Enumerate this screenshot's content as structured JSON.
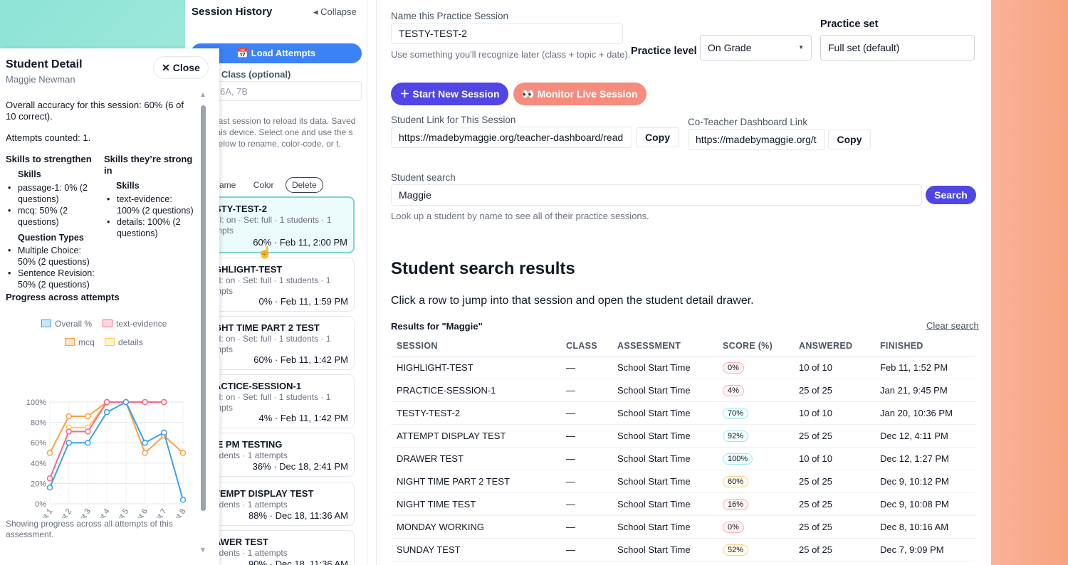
{
  "history": {
    "title": "Session History",
    "collapse_label": "◂ Collapse",
    "load_button": "Load Attempts",
    "filter_label": "y Class (optional)",
    "filter_placeholder": "6A, 7B",
    "help_text": "past session to reload its data. Saved this device. Select one and use the s below to rename, color-code, or t.",
    "actions": [
      "ame",
      "Color",
      "Delete"
    ],
    "sessions": [
      {
        "name": "STY-TEST-2",
        "meta": "el: on · Set: full · 1 students · 1 mpts",
        "foot": "60% · Feb 11, 2:00 PM",
        "active": true
      },
      {
        "name": "GHLIGHT-TEST",
        "meta": "el: on · Set: full · 1 students · 1 mpts",
        "foot": "0% · Feb 11, 1:59 PM"
      },
      {
        "name": "GHT TIME PART 2 TEST",
        "meta": "el: on · Set: full · 1 students · 1 mpts",
        "foot": "60% · Feb 11, 1:42 PM"
      },
      {
        "name": "ACTICE-SESSION-1",
        "meta": "el: on · Set: full · 1 students · 1 mpts",
        "foot": "4% · Feb 11, 1:42 PM"
      },
      {
        "name": "IE PM TESTING",
        "meta": "udents · 1 attempts",
        "foot": "36% · Dec 18, 2:41 PM"
      },
      {
        "name": "TEMPT DISPLAY TEST",
        "meta": "udents · 1 attempts",
        "foot": "88% · Dec 18, 11:36 AM"
      },
      {
        "name": "AWER TEST",
        "meta": "udents · 1 attempts",
        "foot": "90% · Dec 18, 11:36 AM"
      }
    ]
  },
  "drawer": {
    "title": "Student Detail",
    "student": "Maggie Newman",
    "close_label": "Close",
    "accuracy": "Overall accuracy for this session: 60% (6 of 10 correct).",
    "attempts": "Attempts counted: 1.",
    "strengthen_title": "Skills to strengthen",
    "strong_title": "Skills they’re strong in",
    "skills_label": "Skills",
    "question_types_label": "Question Types",
    "strengthen_skills": [
      "passage-1: 0% (2 questions)",
      "mcq: 50% (2 questions)"
    ],
    "strengthen_qtypes": [
      "Multiple Choice: 50% (2 questions)",
      "Sentence Revision: 50% (2 questions)"
    ],
    "strong_skills": [
      "text-evidence: 100% (2 questions)",
      "details: 100% (2 questions)"
    ],
    "progress_title": "Progress across attempts",
    "footnote": "Showing progress across all attempts of this assessment."
  },
  "chart_data": {
    "type": "line",
    "x": [
      "Attempt 1",
      "Attempt 2",
      "Attempt 3",
      "Attempt 4",
      "Attempt 5",
      "Attempt 6",
      "Attempt 7",
      "Attempt 8"
    ],
    "ylim": [
      0,
      100
    ],
    "yticks": [
      "0%",
      "20%",
      "40%",
      "60%",
      "80%",
      "100%"
    ],
    "grid": true,
    "legend": "top",
    "series": [
      {
        "name": "Overall %",
        "color": "#36a2eb",
        "values": [
          16,
          60,
          60,
          90,
          100,
          60,
          70,
          4
        ]
      },
      {
        "name": "text-evidence",
        "color": "#ff6384",
        "values": [
          25,
          71,
          71,
          100,
          100,
          100,
          100,
          null
        ]
      },
      {
        "name": "mcq",
        "color": "#ff9f40",
        "values": [
          50,
          86,
          86,
          100,
          100,
          50,
          67,
          50
        ]
      },
      {
        "name": "details",
        "color": "#ffcd56",
        "values": [
          null,
          75,
          75,
          100,
          100,
          100,
          100,
          null
        ]
      }
    ]
  },
  "form": {
    "name_label": "Name this Practice Session",
    "name_value": "TESTY-TEST-2",
    "name_help": "Use something you'll recognize later (class + topic + date).",
    "level_label": "Practice level",
    "level_value": "On Grade",
    "set_label": "Practice set",
    "set_value": "Full set (default)",
    "start_button": "Start New Session",
    "monitor_button": "Monitor Live Session",
    "student_link_label": "Student Link for This Session",
    "student_link_value": "https://madebymaggie.org/teacher-dashboard/read",
    "coteacher_label": "Co-Teacher Dashboard Link",
    "coteacher_value": "https://madebymaggie.org/t",
    "copy_label": "Copy",
    "search_label": "Student search",
    "search_value": "Maggie",
    "search_button": "Search",
    "search_help": "Look up a student by name to see all of their practice sessions."
  },
  "results": {
    "title": "Student search results",
    "desc": "Click a row to jump into that session and open the student detail drawer.",
    "results_for": "Results for \"Maggie\"",
    "clear_label": "Clear search",
    "columns": [
      "SESSION",
      "CLASS",
      "ASSESSMENT",
      "SCORE (%)",
      "ANSWERED",
      "FINISHED"
    ],
    "rows": [
      {
        "session": "HIGHLIGHT-TEST",
        "class": "—",
        "assessment": "School Start Time",
        "score": "0%",
        "tone": "red",
        "answered": "10 of 10",
        "finished": "Feb 11, 1:52 PM"
      },
      {
        "session": "PRACTICE-SESSION-1",
        "class": "—",
        "assessment": "School Start Time",
        "score": "4%",
        "tone": "red",
        "answered": "25 of 25",
        "finished": "Jan 21, 9:45 PM"
      },
      {
        "session": "TESTY-TEST-2",
        "class": "—",
        "assessment": "School Start Time",
        "score": "70%",
        "tone": "teal",
        "answered": "10 of 10",
        "finished": "Jan 20, 10:36 PM"
      },
      {
        "session": "ATTEMPT DISPLAY TEST",
        "class": "—",
        "assessment": "School Start Time",
        "score": "92%",
        "tone": "teal",
        "answered": "25 of 25",
        "finished": "Dec 12, 4:11 PM"
      },
      {
        "session": "DRAWER TEST",
        "class": "—",
        "assessment": "School Start Time",
        "score": "100%",
        "tone": "teal",
        "answered": "10 of 10",
        "finished": "Dec 12, 1:27 PM"
      },
      {
        "session": "NIGHT TIME PART 2 TEST",
        "class": "—",
        "assessment": "School Start Time",
        "score": "60%",
        "tone": "amber",
        "answered": "25 of 25",
        "finished": "Dec 9, 10:12 PM"
      },
      {
        "session": "NIGHT TIME TEST",
        "class": "—",
        "assessment": "School Start Time",
        "score": "16%",
        "tone": "red",
        "answered": "25 of 25",
        "finished": "Dec 9, 10:08 PM"
      },
      {
        "session": "MONDAY WORKING",
        "class": "—",
        "assessment": "School Start Time",
        "score": "0%",
        "tone": "red",
        "answered": "25 of 25",
        "finished": "Dec 8, 10:16 AM"
      },
      {
        "session": "SUNDAY TEST",
        "class": "—",
        "assessment": "School Start Time",
        "score": "52%",
        "tone": "amber",
        "answered": "25 of 25",
        "finished": "Dec 7, 9:09 PM"
      }
    ]
  }
}
